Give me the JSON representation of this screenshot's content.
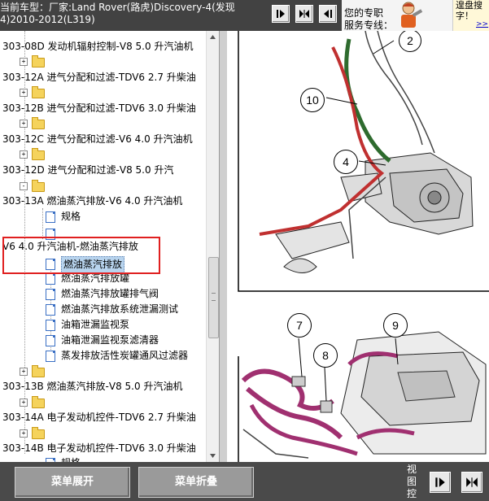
{
  "header": {
    "vehicle_line1": "当前车型：厂家:Land Rover(路虎)Discovery-4(发现",
    "vehicle_line2": "4)2010-2012(L319)"
  },
  "service": {
    "line1": "您的专职",
    "line2": "服务专线：",
    "promo_line1": "遑盘搜",
    "promo_line2": "字！",
    "promo_link": ">>"
  },
  "tree": {
    "rows": [
      {
        "label": "303-08D 发动机辐射控制-V8 5.0 升汽油机"
      },
      {
        "label": ""
      },
      {
        "label": "303-12A 进气分配和过滤-TDV6 2.7 升柴油"
      },
      {
        "label": ""
      },
      {
        "label": "303-12B 进气分配和过滤-TDV6 3.0 升柴油"
      },
      {
        "label": ""
      },
      {
        "label": "303-12C 进气分配和过滤-V6 4.0 升汽油机"
      },
      {
        "label": ""
      },
      {
        "label": "303-12D 进气分配和过滤-V8 5.0 升汽"
      },
      {
        "label": ""
      },
      {
        "label": "303-13A 燃油蒸汽排放-V6 4.0 升汽油机"
      },
      {
        "label": "规格"
      },
      {
        "label": ""
      },
      {
        "label": "V6 4.0 升汽油机-燃油蒸汽排放"
      },
      {
        "label": "燃油蒸汽排放"
      },
      {
        "label": "燃油蒸汽排放罐"
      },
      {
        "label": "燃油蒸汽排放罐排气阀"
      },
      {
        "label": "燃油蒸汽排放系统泄漏测试"
      },
      {
        "label": "油箱泄漏监视泵"
      },
      {
        "label": "油箱泄漏监视泵滤清器"
      },
      {
        "label": "蒸发排放活性炭罐通风过滤器"
      },
      {
        "label": ""
      },
      {
        "label": "303-13B 燃油蒸汽排放-V8 5.0 升汽油机"
      },
      {
        "label": ""
      },
      {
        "label": "303-14A 电子发动机控件-TDV6 2.7 升柴油"
      },
      {
        "label": ""
      },
      {
        "label": "303-14B 电子发动机控件-TDV6 3.0 升柴油"
      },
      {
        "label": "规格"
      }
    ],
    "expander_plus": "+",
    "expander_minus": "-"
  },
  "diagram": {
    "callouts": [
      "2",
      "10",
      "4",
      "7",
      "9",
      "8"
    ]
  },
  "footer": {
    "expand_label": "菜单展开",
    "collapse_label": "菜单折叠",
    "view_label": "视图控"
  },
  "colors": {
    "topbar": "#424242",
    "bottombar": "#4a4a4a",
    "highlight": "#e02020",
    "selection": "#b8d4ee",
    "hose_green": "#2e6b2e",
    "hose_red": "#c03030",
    "hose_purple": "#a03070"
  }
}
